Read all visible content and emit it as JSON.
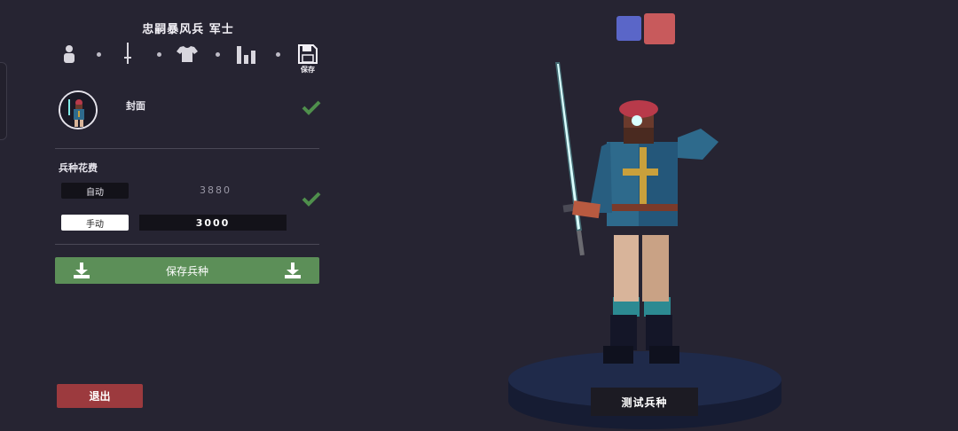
{
  "unit": {
    "title": "忠嗣暴风兵 军士"
  },
  "tabs": {
    "save_label": "保存"
  },
  "cover": {
    "label": "封面"
  },
  "cost": {
    "section_label": "兵种花费",
    "auto_label": "自动",
    "auto_value": "3880",
    "manual_label": "手动",
    "manual_value": "3000"
  },
  "actions": {
    "save_unit_label": "保存兵种",
    "exit_label": "退出",
    "test_unit_label": "测试兵种"
  },
  "teams": {
    "blue_color": "#5a66c8",
    "red_color": "#c85a5c"
  },
  "colors": {
    "check": "#4f8f4c",
    "save_button": "#5c8f58",
    "exit_button": "#9c3a3e",
    "background": "#262432"
  }
}
